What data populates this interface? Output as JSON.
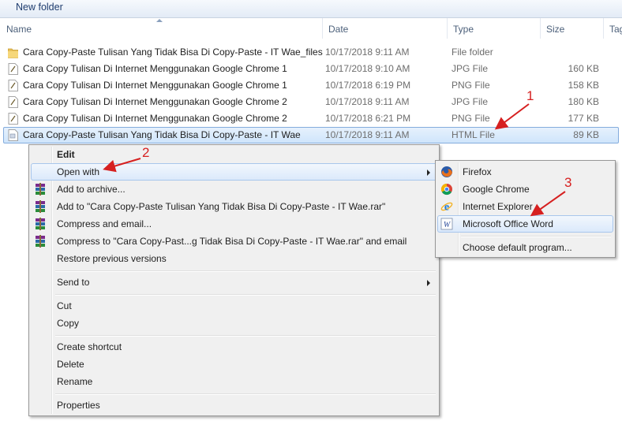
{
  "toolbar": {
    "label": "New folder"
  },
  "columns": {
    "name": "Name",
    "date": "Date",
    "type": "Type",
    "size": "Size",
    "tags": "Tag"
  },
  "files": [
    {
      "name": "Cara Copy-Paste Tulisan Yang Tidak Bisa Di Copy-Paste - IT Wae_files",
      "date": "10/17/2018 9:11 AM",
      "type": "File folder",
      "size": "",
      "icon": "folder-icon"
    },
    {
      "name": "Cara Copy Tulisan Di Internet Menggunakan Google Chrome 1",
      "date": "10/17/2018 9:10 AM",
      "type": "JPG File",
      "size": "160 KB",
      "icon": "image-file-icon"
    },
    {
      "name": "Cara Copy Tulisan Di Internet Menggunakan Google Chrome 1",
      "date": "10/17/2018 6:19 PM",
      "type": "PNG File",
      "size": "158 KB",
      "icon": "image-file-icon"
    },
    {
      "name": "Cara Copy Tulisan Di Internet Menggunakan Google Chrome 2",
      "date": "10/17/2018 9:11 AM",
      "type": "JPG File",
      "size": "180 KB",
      "icon": "image-file-icon"
    },
    {
      "name": "Cara Copy Tulisan Di Internet Menggunakan Google Chrome 2",
      "date": "10/17/2018 6:21 PM",
      "type": "PNG File",
      "size": "177 KB",
      "icon": "image-file-icon"
    },
    {
      "name": "Cara Copy-Paste Tulisan Yang Tidak Bisa Di Copy-Paste - IT Wae",
      "date": "10/17/2018 9:11 AM",
      "type": "HTML File",
      "size": "89 KB",
      "icon": "html-file-icon"
    }
  ],
  "context_menu": {
    "edit": "Edit",
    "open_with": "Open with",
    "add_archive": "Add to archive...",
    "add_to_rar": "Add to \"Cara Copy-Paste Tulisan Yang Tidak Bisa Di Copy-Paste - IT Wae.rar\"",
    "compress_email": "Compress and email...",
    "compress_to_rar_email": "Compress to \"Cara Copy-Past...g Tidak Bisa Di Copy-Paste - IT Wae.rar\" and email",
    "restore": "Restore previous versions",
    "send_to": "Send to",
    "cut": "Cut",
    "copy": "Copy",
    "create_shortcut": "Create shortcut",
    "delete": "Delete",
    "rename": "Rename",
    "properties": "Properties"
  },
  "open_with_menu": {
    "firefox": "Firefox",
    "chrome": "Google Chrome",
    "ie": "Internet Explorer",
    "word": "Microsoft Office Word",
    "default": "Choose default program..."
  },
  "annotations": {
    "a1": "1",
    "a2": "2",
    "a3": "3"
  },
  "colors": {
    "annotation": "#d62020",
    "selection_border": "#84acdd"
  }
}
